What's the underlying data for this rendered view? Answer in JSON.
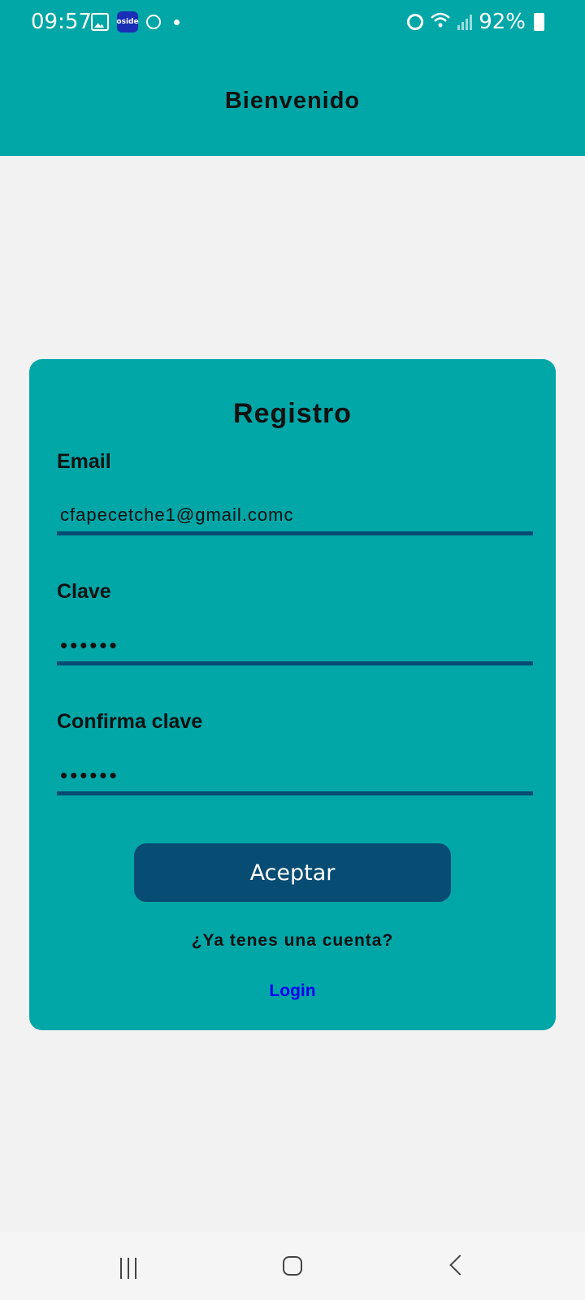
{
  "status_bar": {
    "time": "09:57",
    "app_icon_text": "oside",
    "battery": "92%"
  },
  "header": {
    "title": "Bienvenido"
  },
  "form": {
    "title": "Registro",
    "email_label": "Email",
    "email_value": "cfapecetche1@gmail.comc",
    "password_label": "Clave",
    "password_value": "••••••",
    "confirm_label": "Confirma clave",
    "confirm_value": "••••••",
    "accept_label": "Aceptar",
    "question": "¿Ya tenes una cuenta?",
    "login_link": "Login"
  },
  "colors": {
    "primary": "#01a6a7",
    "accent": "#064c73",
    "link": "#0000ee",
    "background": "#f2f2f2"
  },
  "icons": {
    "status_left": [
      "gallery-icon",
      "oside-app-icon",
      "globe-icon",
      "notification-dot-icon"
    ],
    "status_right": [
      "alarm-icon",
      "wifi-icon",
      "signal-icon",
      "battery-icon"
    ],
    "nav": [
      "recent-apps-icon",
      "home-icon",
      "back-icon"
    ]
  }
}
